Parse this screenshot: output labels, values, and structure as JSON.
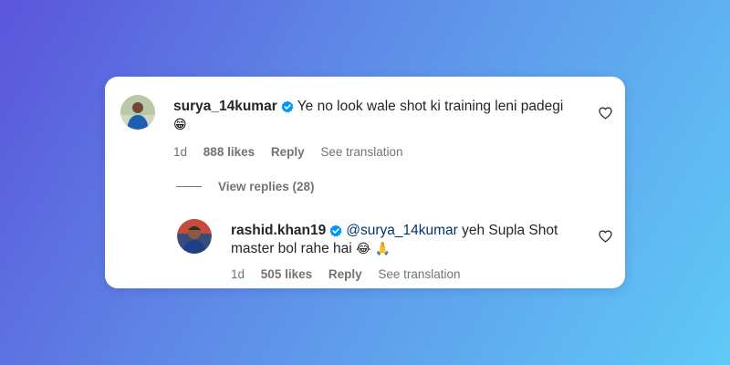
{
  "comment": {
    "username": "surya_14kumar",
    "text": "Ye no look wale shot ki training leni padegi",
    "emoji": "😁",
    "time": "1d",
    "likes": "888 likes",
    "reply_label": "Reply",
    "translate_label": "See translation"
  },
  "view_replies": "View replies (28)",
  "reply": {
    "username": "rashid.khan19",
    "mention": "@surya_14kumar",
    "text_line1": " yeh Supla Shot",
    "text_line2": "master bol rahe hai",
    "emojis": "😂 🙏",
    "time": "1d",
    "likes": "505 likes",
    "reply_label": "Reply",
    "translate_label": "See translation"
  },
  "colors": {
    "verified": "#0095f6",
    "meta_text": "#737373",
    "mention": "#00376b"
  },
  "icons": [
    "verified-badge-icon",
    "heart-icon"
  ]
}
